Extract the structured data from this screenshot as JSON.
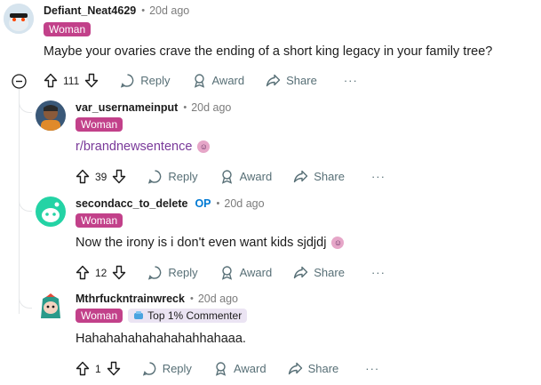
{
  "comments": [
    {
      "username": "Defiant_Neat4629",
      "time": "20d ago",
      "flair": "Woman",
      "text": "Maybe your ovaries crave the ending of a short king legacy in your family tree?",
      "votes": "111",
      "actions": {
        "reply": "Reply",
        "award": "Award",
        "share": "Share",
        "more": "···"
      }
    },
    {
      "username": "var_usernameinput",
      "time": "20d ago",
      "flair": "Woman",
      "text": "r/brandnewsentence",
      "votes": "39",
      "actions": {
        "reply": "Reply",
        "award": "Award",
        "share": "Share",
        "more": "···"
      }
    },
    {
      "username": "secondacc_to_delete",
      "op": "OP",
      "time": "20d ago",
      "flair": "Woman",
      "text": "Now the irony is i don't even want kids sjdjdj",
      "votes": "12",
      "actions": {
        "reply": "Reply",
        "award": "Award",
        "share": "Share",
        "more": "···"
      }
    },
    {
      "username": "Mthrfuckntrainwreck",
      "time": "20d ago",
      "flair": "Woman",
      "flair2": "Top 1% Commenter",
      "text": "Hahahahahahahahahhahaaa.",
      "votes": "1",
      "actions": {
        "reply": "Reply",
        "award": "Award",
        "share": "Share",
        "more": "···"
      }
    }
  ],
  "colors": {
    "flair_bg": "#c2418a",
    "link": "#7a3a9a",
    "op": "#0079d3",
    "muted": "#576f76"
  },
  "icons": [
    "upvote-icon",
    "downvote-icon",
    "reply-icon",
    "award-icon",
    "share-icon",
    "collapse-icon"
  ]
}
